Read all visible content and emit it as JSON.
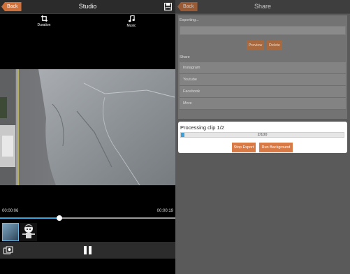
{
  "left": {
    "back_label": "Back",
    "title": "Studio",
    "tools": {
      "duration": "Duration",
      "music": "Music"
    },
    "time_start": "00:00:06",
    "time_end": "00:00:19",
    "playback_progress": 0.34,
    "icons": [
      "save-icon",
      "crop-icon",
      "music-note-icon",
      "settings-icon",
      "pause-icon"
    ]
  },
  "right": {
    "back_label": "Back",
    "title": "Share",
    "exporting_label": "Exporting...",
    "preview_label": "Preview",
    "delete_label": "Delete",
    "share_label": "Share",
    "share_options": [
      "Instagram",
      "Youtube",
      "Facebook",
      "More"
    ]
  },
  "dialog": {
    "title": "Processing clip 1/2",
    "progress_text": "2/100",
    "progress_value": 2,
    "progress_max": 100,
    "stop_label": "Stop Export",
    "run_bg_label": "Run Background"
  },
  "colors": {
    "accent": "#d87a45",
    "progress": "#3fa1d8"
  }
}
